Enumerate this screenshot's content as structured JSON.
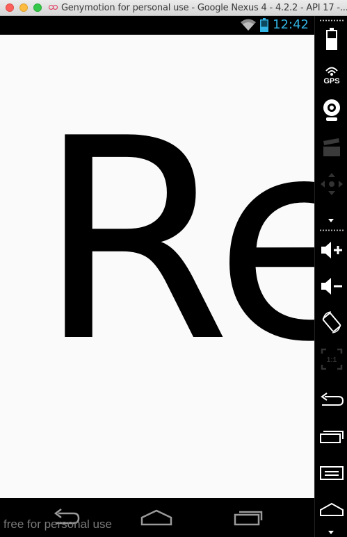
{
  "window": {
    "title": "Genymotion for personal use - Google Nexus 4 - 4.2.2 - API 17 -..."
  },
  "statusbar": {
    "time": "12:42",
    "icons": [
      "wifi-icon",
      "battery-icon"
    ]
  },
  "screen": {
    "display_text": "Re",
    "watermark": "free for personal use"
  },
  "navbar": {
    "buttons": [
      "back-icon",
      "home-icon",
      "recent-apps-icon"
    ]
  },
  "toolbar": {
    "tools": [
      {
        "name": "battery-tool",
        "icon": "battery-icon"
      },
      {
        "name": "gps-tool",
        "icon": "gps-icon",
        "label": "GPS"
      },
      {
        "name": "webcam-tool",
        "icon": "webcam-icon"
      },
      {
        "name": "media-capture-tool",
        "icon": "clapperboard-icon"
      },
      {
        "name": "dpad-tool",
        "icon": "dpad-icon"
      },
      {
        "name": "volume-up-tool",
        "icon": "volume-up-icon"
      },
      {
        "name": "volume-down-tool",
        "icon": "volume-down-icon"
      },
      {
        "name": "rotate-tool",
        "icon": "rotate-icon"
      },
      {
        "name": "pixel-perfect-tool",
        "icon": "scale-icon",
        "label": "1:1"
      },
      {
        "name": "back-tool",
        "icon": "back-icon"
      },
      {
        "name": "recent-apps-tool",
        "icon": "recent-apps-icon"
      },
      {
        "name": "menu-tool",
        "icon": "menu-icon"
      },
      {
        "name": "home-tool",
        "icon": "home-icon"
      }
    ],
    "colors": {
      "icon": "#ffffff",
      "disabled": "#444444",
      "accent": "#33b5e5"
    }
  }
}
